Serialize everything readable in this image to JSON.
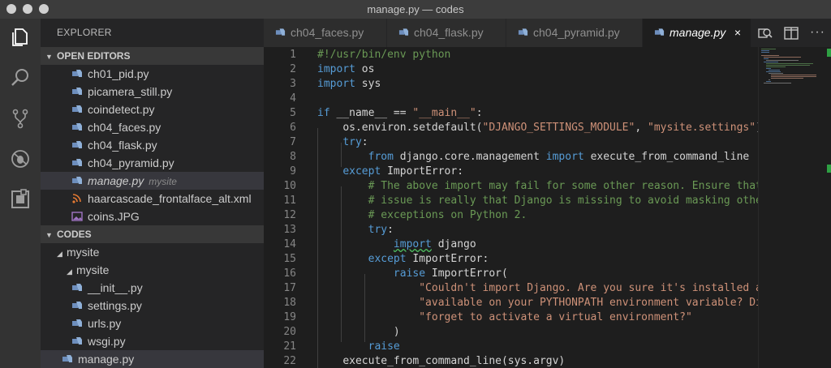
{
  "window": {
    "title": "manage.py — codes"
  },
  "colors": {
    "activity_bar": "#333333",
    "sidebar": "#252526",
    "editor": "#1e1e1e",
    "keyword": "#569cd6",
    "string": "#ce9178",
    "comment": "#6a9955"
  },
  "activity_bar": {
    "icons": [
      "files-icon",
      "search-icon",
      "source-control-icon",
      "debug-icon",
      "extensions-icon"
    ]
  },
  "sidebar": {
    "title": "EXPLORER",
    "open_editors": {
      "label": "OPEN EDITORS",
      "items": [
        {
          "name": "ch01_pid.py"
        },
        {
          "name": "picamera_still.py"
        },
        {
          "name": "coindetect.py"
        },
        {
          "name": "ch04_faces.py"
        },
        {
          "name": "ch04_flask.py"
        },
        {
          "name": "ch04_pyramid.py"
        },
        {
          "name": "manage.py",
          "description": "mysite"
        },
        {
          "name": "haarcascade_frontalface_alt.xml"
        },
        {
          "name": "coins.JPG"
        }
      ]
    },
    "codes": {
      "label": "CODES",
      "folder_mysite": "mysite",
      "subfolder_mysite": "mysite",
      "files": [
        "__init__.py",
        "settings.py",
        "urls.py",
        "wsgi.py"
      ],
      "root_file": "manage.py"
    }
  },
  "tabs": [
    {
      "label": "ch04_faces.py"
    },
    {
      "label": "ch04_flask.py"
    },
    {
      "label": "ch04_pyramid.py"
    },
    {
      "label": "manage.py",
      "close": "×"
    }
  ],
  "editor": {
    "line_numbers": [
      "1",
      "2",
      "3",
      "4",
      "5",
      "6",
      "7",
      "8",
      "9",
      "10",
      "11",
      "12",
      "13",
      "14",
      "15",
      "16",
      "17",
      "18",
      "19",
      "20",
      "21",
      "22"
    ],
    "tokens": {
      "l1": "#!/usr/bin/env python",
      "import": "import",
      "os": " os",
      "sys": " sys",
      "if": "if",
      "l5_a": " __name__ == ",
      "l5_main": "\"__main__\"",
      "colon": ":",
      "l6_a": "os.environ.setdefault(",
      "l6_s1": "\"DJANGO_SETTINGS_MODULE\"",
      "l6_comma": ", ",
      "l6_s2": "\"mysite.settings\"",
      "close_paren": ")",
      "try": "try",
      "from": "from",
      "l8_mod": " django.core.management ",
      "l8_name": " execute_from_command_line",
      "except": "except",
      "importerror": " ImportError:",
      "l10": "# The above import may fail for some other reason. Ensure that the",
      "l11": "# issue is really that Django is missing to avoid masking other",
      "l12": "# exceptions on Python 2.",
      "django": " django",
      "raise": "raise",
      "l16_a": " ImportError(",
      "l17": "\"Couldn't import Django. Are you sure it's installed and \"",
      "l18": "\"available on your PYTHONPATH environment variable? Did you",
      "l19": "\"forget to activate a virtual environment?\"",
      "l22": "execute_from_command_line(sys.argv)"
    }
  }
}
